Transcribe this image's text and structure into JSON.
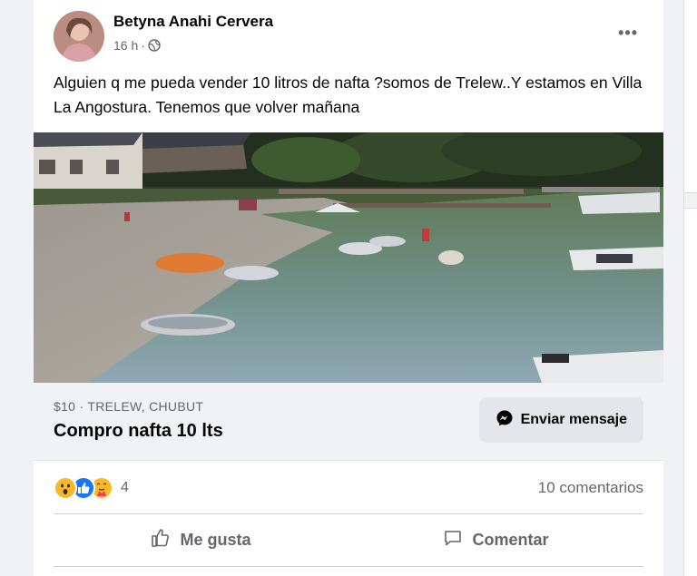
{
  "post": {
    "author": "Betyna Anahi Cervera",
    "time": "16 h",
    "separator": "·",
    "more": "•••",
    "text": "Alguien q me pueda vender 10 litros de nafta ?somos de Trelew..Y estamos en Villa La Angostura. Tenemos que volver mañana"
  },
  "listing": {
    "price_location": "$10 · TRELEW, CHUBUT",
    "title": "Compro nafta 10 lts",
    "message_button": "Enviar mensaje"
  },
  "engagement": {
    "reactions": [
      "wow",
      "like",
      "care"
    ],
    "reaction_count": "4",
    "comments": "10 comentarios"
  },
  "actions": {
    "like": "Me gusta",
    "comment": "Comentar"
  },
  "colors": {
    "like_blue": "#1877f2",
    "wow_yellow": "#f7b928",
    "text_secondary": "#65676b"
  }
}
